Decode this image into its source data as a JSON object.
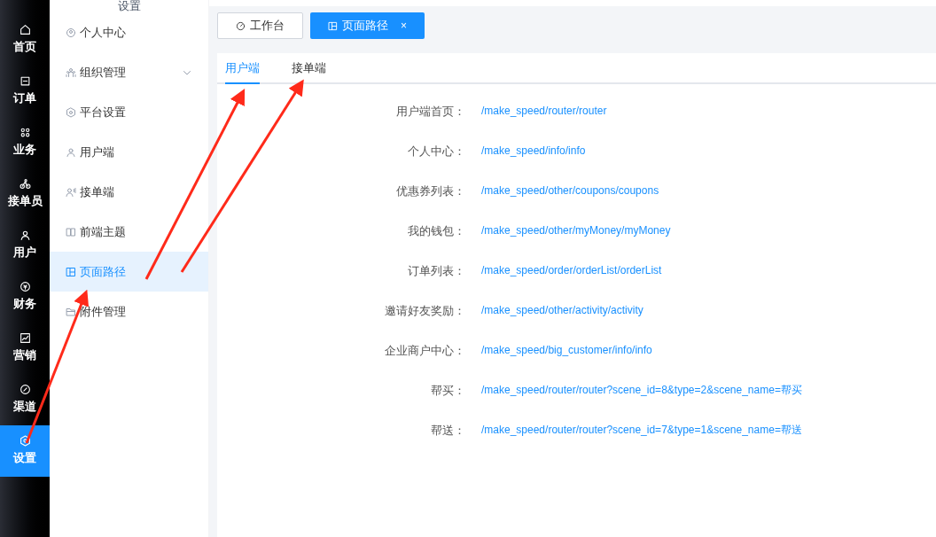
{
  "rail": [
    {
      "label": "首页",
      "selected": false
    },
    {
      "label": "订单",
      "selected": false
    },
    {
      "label": "业务",
      "selected": false
    },
    {
      "label": "接单员",
      "selected": false
    },
    {
      "label": "用户",
      "selected": false
    },
    {
      "label": "财务",
      "selected": false
    },
    {
      "label": "营销",
      "selected": false
    },
    {
      "label": "渠道",
      "selected": false
    },
    {
      "label": "设置",
      "selected": true
    }
  ],
  "submenu": {
    "title": "设置",
    "items": [
      {
        "label": "个人中心",
        "selected": false,
        "expandable": false
      },
      {
        "label": "组织管理",
        "selected": false,
        "expandable": true
      },
      {
        "label": "平台设置",
        "selected": false,
        "expandable": false
      },
      {
        "label": "用户端",
        "selected": false,
        "expandable": false
      },
      {
        "label": "接单端",
        "selected": false,
        "expandable": false
      },
      {
        "label": "前端主题",
        "selected": false,
        "expandable": false
      },
      {
        "label": "页面路径",
        "selected": true,
        "expandable": false
      },
      {
        "label": "附件管理",
        "selected": false,
        "expandable": false
      }
    ]
  },
  "page_tabs": [
    {
      "label": "工作台",
      "selected": false,
      "closable": false
    },
    {
      "label": "页面路径",
      "selected": true,
      "closable": true,
      "close": "×"
    }
  ],
  "tabs": [
    {
      "label": "用户端",
      "selected": true
    },
    {
      "label": "接单端",
      "selected": false
    }
  ],
  "routes": [
    {
      "label": "用户端首页：",
      "path": "/make_speed/router/router"
    },
    {
      "label": "个人中心：",
      "path": "/make_speed/info/info"
    },
    {
      "label": "优惠券列表：",
      "path": "/make_speed/other/coupons/coupons"
    },
    {
      "label": "我的钱包：",
      "path": "/make_speed/other/myMoney/myMoney"
    },
    {
      "label": "订单列表：",
      "path": "/make_speed/order/orderList/orderList"
    },
    {
      "label": "邀请好友奖励：",
      "path": "/make_speed/other/activity/activity"
    },
    {
      "label": "企业商户中心：",
      "path": "/make_speed/big_customer/info/info"
    },
    {
      "label": "帮买：",
      "path": "/make_speed/router/router?scene_id=8&type=2&scene_name=帮买"
    },
    {
      "label": "帮送：",
      "path": "/make_speed/router/router?scene_id=7&type=1&scene_name=帮送"
    }
  ]
}
